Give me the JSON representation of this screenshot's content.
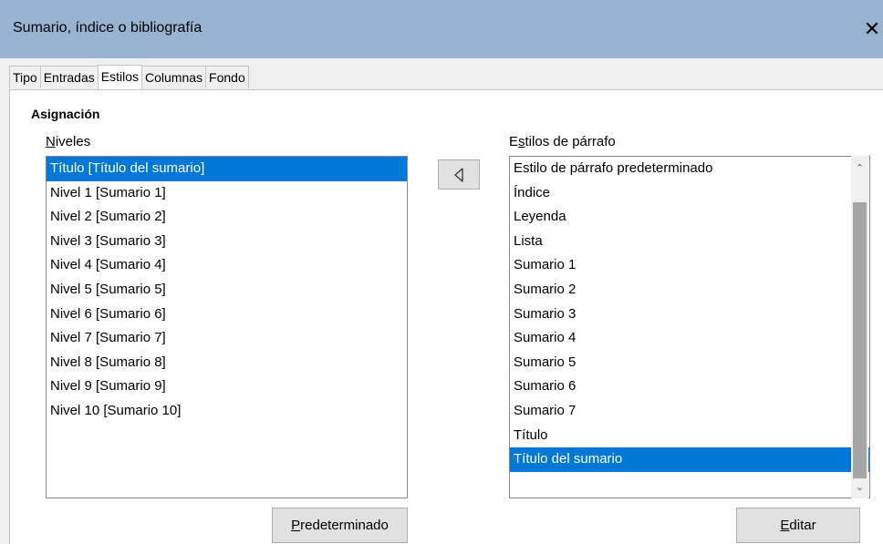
{
  "window": {
    "title": "Sumario, índice o bibliografía",
    "close_glyph": "✕"
  },
  "tabs": [
    {
      "label": "Tipo"
    },
    {
      "label": "Entradas"
    },
    {
      "label": "Estilos",
      "active": true
    },
    {
      "label": "Columnas"
    },
    {
      "label": "Fondo"
    }
  ],
  "assignment": {
    "heading": "Asignación",
    "levels_label": "Niveles",
    "levels": [
      "Título [Título del sumario]",
      "Nivel 1 [Sumario 1]",
      "Nivel 2 [Sumario 2]",
      "Nivel 3 [Sumario 3]",
      "Nivel 4 [Sumario 4]",
      "Nivel 5 [Sumario 5]",
      "Nivel 6 [Sumario 6]",
      "Nivel 7 [Sumario 7]",
      "Nivel 8 [Sumario 8]",
      "Nivel 9 [Sumario 9]",
      "Nivel 10 [Sumario 10]"
    ],
    "levels_selected_index": 0,
    "assign_button_icon": "triangle-left-icon",
    "styles_label": "Estilos de párrafo",
    "styles": [
      "Estilo de párrafo predeterminado",
      "Índice",
      "Leyenda",
      "Lista",
      "Sumario 1",
      "Sumario 2",
      "Sumario 3",
      "Sumario 4",
      "Sumario 5",
      "Sumario 6",
      "Sumario 7",
      "Título",
      "Título del sumario"
    ],
    "styles_selected_index": 12,
    "default_button": "Predeterminado",
    "edit_button": "Editar"
  },
  "colors": {
    "titlebar": "#99b4d1",
    "selection": "#0078d7",
    "active_tab_indicator": "#e8101a"
  }
}
